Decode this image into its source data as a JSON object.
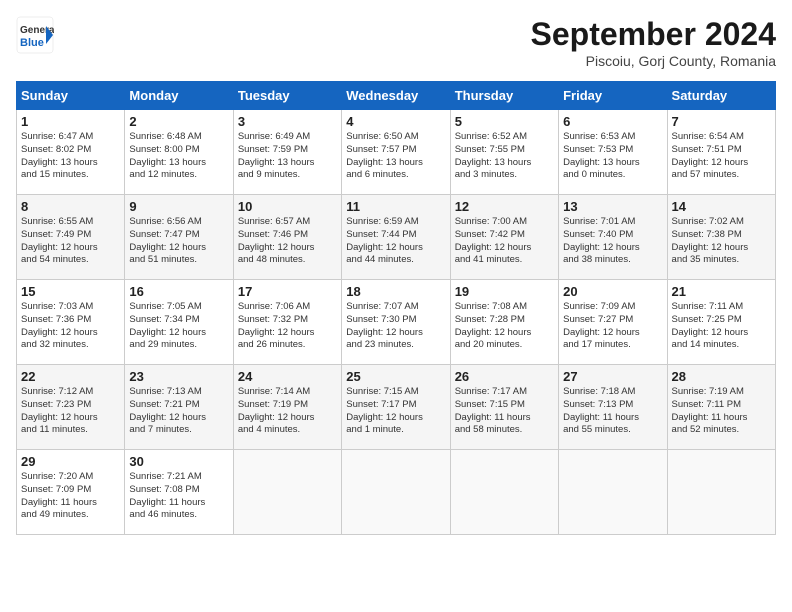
{
  "header": {
    "logo_line1": "General",
    "logo_line2": "Blue",
    "month": "September 2024",
    "location": "Piscoiu, Gorj County, Romania"
  },
  "days_of_week": [
    "Sunday",
    "Monday",
    "Tuesday",
    "Wednesday",
    "Thursday",
    "Friday",
    "Saturday"
  ],
  "weeks": [
    [
      {
        "day": "1",
        "lines": [
          "Sunrise: 6:47 AM",
          "Sunset: 8:02 PM",
          "Daylight: 13 hours",
          "and 15 minutes."
        ]
      },
      {
        "day": "2",
        "lines": [
          "Sunrise: 6:48 AM",
          "Sunset: 8:00 PM",
          "Daylight: 13 hours",
          "and 12 minutes."
        ]
      },
      {
        "day": "3",
        "lines": [
          "Sunrise: 6:49 AM",
          "Sunset: 7:59 PM",
          "Daylight: 13 hours",
          "and 9 minutes."
        ]
      },
      {
        "day": "4",
        "lines": [
          "Sunrise: 6:50 AM",
          "Sunset: 7:57 PM",
          "Daylight: 13 hours",
          "and 6 minutes."
        ]
      },
      {
        "day": "5",
        "lines": [
          "Sunrise: 6:52 AM",
          "Sunset: 7:55 PM",
          "Daylight: 13 hours",
          "and 3 minutes."
        ]
      },
      {
        "day": "6",
        "lines": [
          "Sunrise: 6:53 AM",
          "Sunset: 7:53 PM",
          "Daylight: 13 hours",
          "and 0 minutes."
        ]
      },
      {
        "day": "7",
        "lines": [
          "Sunrise: 6:54 AM",
          "Sunset: 7:51 PM",
          "Daylight: 12 hours",
          "and 57 minutes."
        ]
      }
    ],
    [
      {
        "day": "8",
        "lines": [
          "Sunrise: 6:55 AM",
          "Sunset: 7:49 PM",
          "Daylight: 12 hours",
          "and 54 minutes."
        ]
      },
      {
        "day": "9",
        "lines": [
          "Sunrise: 6:56 AM",
          "Sunset: 7:47 PM",
          "Daylight: 12 hours",
          "and 51 minutes."
        ]
      },
      {
        "day": "10",
        "lines": [
          "Sunrise: 6:57 AM",
          "Sunset: 7:46 PM",
          "Daylight: 12 hours",
          "and 48 minutes."
        ]
      },
      {
        "day": "11",
        "lines": [
          "Sunrise: 6:59 AM",
          "Sunset: 7:44 PM",
          "Daylight: 12 hours",
          "and 44 minutes."
        ]
      },
      {
        "day": "12",
        "lines": [
          "Sunrise: 7:00 AM",
          "Sunset: 7:42 PM",
          "Daylight: 12 hours",
          "and 41 minutes."
        ]
      },
      {
        "day": "13",
        "lines": [
          "Sunrise: 7:01 AM",
          "Sunset: 7:40 PM",
          "Daylight: 12 hours",
          "and 38 minutes."
        ]
      },
      {
        "day": "14",
        "lines": [
          "Sunrise: 7:02 AM",
          "Sunset: 7:38 PM",
          "Daylight: 12 hours",
          "and 35 minutes."
        ]
      }
    ],
    [
      {
        "day": "15",
        "lines": [
          "Sunrise: 7:03 AM",
          "Sunset: 7:36 PM",
          "Daylight: 12 hours",
          "and 32 minutes."
        ]
      },
      {
        "day": "16",
        "lines": [
          "Sunrise: 7:05 AM",
          "Sunset: 7:34 PM",
          "Daylight: 12 hours",
          "and 29 minutes."
        ]
      },
      {
        "day": "17",
        "lines": [
          "Sunrise: 7:06 AM",
          "Sunset: 7:32 PM",
          "Daylight: 12 hours",
          "and 26 minutes."
        ]
      },
      {
        "day": "18",
        "lines": [
          "Sunrise: 7:07 AM",
          "Sunset: 7:30 PM",
          "Daylight: 12 hours",
          "and 23 minutes."
        ]
      },
      {
        "day": "19",
        "lines": [
          "Sunrise: 7:08 AM",
          "Sunset: 7:28 PM",
          "Daylight: 12 hours",
          "and 20 minutes."
        ]
      },
      {
        "day": "20",
        "lines": [
          "Sunrise: 7:09 AM",
          "Sunset: 7:27 PM",
          "Daylight: 12 hours",
          "and 17 minutes."
        ]
      },
      {
        "day": "21",
        "lines": [
          "Sunrise: 7:11 AM",
          "Sunset: 7:25 PM",
          "Daylight: 12 hours",
          "and 14 minutes."
        ]
      }
    ],
    [
      {
        "day": "22",
        "lines": [
          "Sunrise: 7:12 AM",
          "Sunset: 7:23 PM",
          "Daylight: 12 hours",
          "and 11 minutes."
        ]
      },
      {
        "day": "23",
        "lines": [
          "Sunrise: 7:13 AM",
          "Sunset: 7:21 PM",
          "Daylight: 12 hours",
          "and 7 minutes."
        ]
      },
      {
        "day": "24",
        "lines": [
          "Sunrise: 7:14 AM",
          "Sunset: 7:19 PM",
          "Daylight: 12 hours",
          "and 4 minutes."
        ]
      },
      {
        "day": "25",
        "lines": [
          "Sunrise: 7:15 AM",
          "Sunset: 7:17 PM",
          "Daylight: 12 hours",
          "and 1 minute."
        ]
      },
      {
        "day": "26",
        "lines": [
          "Sunrise: 7:17 AM",
          "Sunset: 7:15 PM",
          "Daylight: 11 hours",
          "and 58 minutes."
        ]
      },
      {
        "day": "27",
        "lines": [
          "Sunrise: 7:18 AM",
          "Sunset: 7:13 PM",
          "Daylight: 11 hours",
          "and 55 minutes."
        ]
      },
      {
        "day": "28",
        "lines": [
          "Sunrise: 7:19 AM",
          "Sunset: 7:11 PM",
          "Daylight: 11 hours",
          "and 52 minutes."
        ]
      }
    ],
    [
      {
        "day": "29",
        "lines": [
          "Sunrise: 7:20 AM",
          "Sunset: 7:09 PM",
          "Daylight: 11 hours",
          "and 49 minutes."
        ]
      },
      {
        "day": "30",
        "lines": [
          "Sunrise: 7:21 AM",
          "Sunset: 7:08 PM",
          "Daylight: 11 hours",
          "and 46 minutes."
        ]
      },
      {
        "day": "",
        "lines": []
      },
      {
        "day": "",
        "lines": []
      },
      {
        "day": "",
        "lines": []
      },
      {
        "day": "",
        "lines": []
      },
      {
        "day": "",
        "lines": []
      }
    ]
  ]
}
